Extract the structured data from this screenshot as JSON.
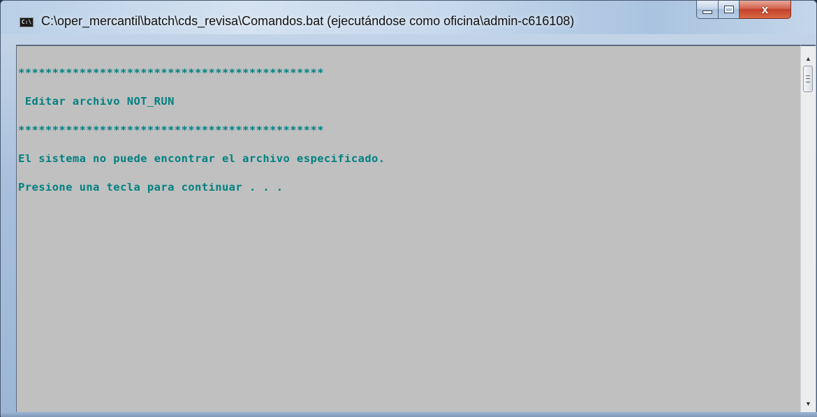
{
  "window": {
    "title": "C:\\oper_mercantil\\batch\\cds_revisa\\Comandos.bat (ejecutándose como oficina\\admin-c616108)",
    "icon": "cmd-console-icon",
    "icon_label": "C:\\",
    "buttons": {
      "minimize": "minimize-icon",
      "maximize": "maximize-icon",
      "close_label": "x"
    }
  },
  "console": {
    "lines": [
      "*********************************************",
      " Editar archivo NOT_RUN",
      "*********************************************",
      "El sistema no puede encontrar el archivo especificado.",
      "Presione una tecla para continuar . . ."
    ],
    "background_color": "#c0c0c0",
    "text_color": "#008080"
  },
  "scrollbar": {
    "up_arrow": "▲",
    "down_arrow": "▼"
  }
}
